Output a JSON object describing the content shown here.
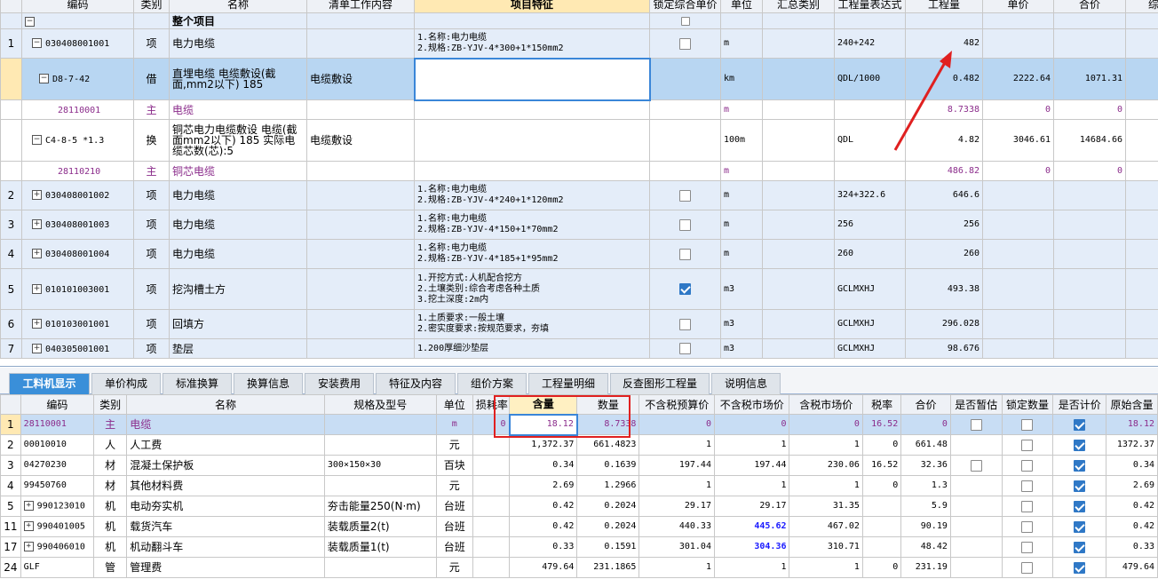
{
  "top": {
    "headers": [
      "编码",
      "类别",
      "名称",
      "清单工作内容",
      "项目特征",
      "锁定综合单价",
      "单位",
      "汇总类别",
      "工程量表达式",
      "工程量",
      "单价",
      "合价",
      "综"
    ],
    "project_row": {
      "name": "整个项目"
    },
    "rows": [
      {
        "no": "1",
        "code": "030408001001",
        "type": "项",
        "name": "电力电缆",
        "work": "",
        "feature": [
          "1.名称:电力电缆",
          "2.规格:ZB-YJV-4*300+1*150mm2"
        ],
        "unit": "m",
        "expr": "240+242",
        "qty": "482",
        "price": "",
        "total": "",
        "lock": false
      },
      {
        "no": "",
        "code": "D8-7-42",
        "type": "借",
        "name": "直埋电缆 电缆敷设(截面,mm2以下) 185",
        "work": "电缆敷设",
        "feature": [],
        "unit": "km",
        "expr": "QDL/1000",
        "qty": "0.482",
        "price": "2222.64",
        "total": "1071.31"
      },
      {
        "no": "",
        "code": "28110001",
        "type": "主",
        "name": "电缆",
        "work": "",
        "feature": [],
        "unit": "m",
        "expr": "",
        "qty": "8.7338",
        "price": "0",
        "total": "0"
      },
      {
        "no": "",
        "code": "C4-8-5 *1.3",
        "type": "换",
        "name": "铜芯电力电缆敷设 电缆(截面mm2以下) 185  实际电缆芯数(芯):5",
        "work": "电缆敷设",
        "feature": [],
        "unit": "100m",
        "expr": "QDL",
        "qty": "4.82",
        "price": "3046.61",
        "total": "14684.66"
      },
      {
        "no": "",
        "code": "28110210",
        "type": "主",
        "name": "铜芯电缆",
        "work": "",
        "feature": [],
        "unit": "m",
        "expr": "",
        "qty": "486.82",
        "price": "0",
        "total": "0"
      },
      {
        "no": "2",
        "code": "030408001002",
        "type": "项",
        "name": "电力电缆",
        "work": "",
        "feature": [
          "1.名称:电力电缆",
          "2.规格:ZB-YJV-4*240+1*120mm2"
        ],
        "unit": "m",
        "expr": "324+322.6",
        "qty": "646.6",
        "lock": false
      },
      {
        "no": "3",
        "code": "030408001003",
        "type": "项",
        "name": "电力电缆",
        "work": "",
        "feature": [
          "1.名称:电力电缆",
          "2.规格:ZB-YJV-4*150+1*70mm2"
        ],
        "unit": "m",
        "expr": "256",
        "qty": "256",
        "lock": false
      },
      {
        "no": "4",
        "code": "030408001004",
        "type": "项",
        "name": "电力电缆",
        "work": "",
        "feature": [
          "1.名称:电力电缆",
          "2.规格:ZB-YJV-4*185+1*95mm2"
        ],
        "unit": "m",
        "expr": "260",
        "qty": "260",
        "lock": false
      },
      {
        "no": "5",
        "code": "010101003001",
        "type": "项",
        "name": "挖沟槽土方",
        "work": "",
        "feature": [
          "1.开挖方式:人机配合挖方",
          "2.土壤类别:综合考虑各种土质",
          "3.挖土深度:2m内"
        ],
        "unit": "m3",
        "expr": "GCLMXHJ",
        "qty": "493.38",
        "lock": true
      },
      {
        "no": "6",
        "code": "010103001001",
        "type": "项",
        "name": "回填方",
        "work": "",
        "feature": [
          "1.土质要求:一般土壤",
          "2.密实度要求:按规范要求，夯填"
        ],
        "unit": "m3",
        "expr": "GCLMXHJ",
        "qty": "296.028",
        "lock": false
      },
      {
        "no": "7",
        "code": "040305001001",
        "type": "项",
        "name": "垫层",
        "work": "",
        "feature": [
          "1.200厚细沙垫层"
        ],
        "unit": "m3",
        "expr": "GCLMXHJ",
        "qty": "98.676",
        "lock": false
      }
    ]
  },
  "tabs": [
    "工料机显示",
    "单价构成",
    "标准换算",
    "换算信息",
    "安装费用",
    "特征及内容",
    "组价方案",
    "工程量明细",
    "反查图形工程量",
    "说明信息"
  ],
  "bottom": {
    "headers": [
      "",
      "编码",
      "类别",
      "名称",
      "规格及型号",
      "单位",
      "损耗率",
      "含量",
      "数量",
      "不含税预算价",
      "不含税市场价",
      "含税市场价",
      "税率",
      "合价",
      "是否暂估",
      "锁定数量",
      "是否计价",
      "原始含量"
    ],
    "rows": [
      {
        "no": "1",
        "code": "28110001",
        "type": "主",
        "name": "电缆",
        "spec": "",
        "unit": "m",
        "loss": "0",
        "content": "18.12",
        "qty": "8.7338",
        "pre": "0",
        "mkt": "0",
        "mkt_tax": "0",
        "tax": "16.52",
        "total": "0",
        "est": false,
        "lockq": false,
        "priced": true,
        "orig": "18.12"
      },
      {
        "no": "2",
        "code": "00010010",
        "type": "人",
        "name": "人工费",
        "spec": "",
        "unit": "元",
        "loss": "",
        "content": "1,372.37",
        "qty": "661.4823",
        "pre": "1",
        "mkt": "1",
        "mkt_tax": "1",
        "tax": "0",
        "total": "661.48",
        "est": null,
        "lockq": false,
        "priced": true,
        "orig": "1372.37"
      },
      {
        "no": "3",
        "code": "04270230",
        "type": "材",
        "name": "混凝土保护板",
        "spec": "300×150×30",
        "unit": "百块",
        "loss": "",
        "content": "0.34",
        "qty": "0.1639",
        "pre": "197.44",
        "mkt": "197.44",
        "mkt_tax": "230.06",
        "tax": "16.52",
        "total": "32.36",
        "est": false,
        "lockq": false,
        "priced": true,
        "orig": "0.34"
      },
      {
        "no": "4",
        "code": "99450760",
        "type": "材",
        "name": "其他材料费",
        "spec": "",
        "unit": "元",
        "loss": "",
        "content": "2.69",
        "qty": "1.2966",
        "pre": "1",
        "mkt": "1",
        "mkt_tax": "1",
        "tax": "0",
        "total": "1.3",
        "est": null,
        "lockq": false,
        "priced": true,
        "orig": "2.69"
      },
      {
        "no": "5",
        "code": "990123010",
        "type": "机",
        "name": "电动夯实机",
        "spec": "夯击能量250(N·m)",
        "unit": "台班",
        "loss": "",
        "content": "0.42",
        "qty": "0.2024",
        "pre": "29.17",
        "mkt": "29.17",
        "mkt_tax": "31.35",
        "tax": "",
        "total": "5.9",
        "est": null,
        "lockq": false,
        "priced": true,
        "orig": "0.42",
        "expand": true
      },
      {
        "no": "11",
        "code": "990401005",
        "type": "机",
        "name": "载货汽车",
        "spec": "装载质量2(t)",
        "unit": "台班",
        "loss": "",
        "content": "0.42",
        "qty": "0.2024",
        "pre": "440.33",
        "mkt": "445.62",
        "mkt_tax": "467.02",
        "tax": "",
        "total": "90.19",
        "est": null,
        "lockq": false,
        "priced": true,
        "orig": "0.42",
        "expand": true,
        "mkt_bold": true
      },
      {
        "no": "17",
        "code": "990406010",
        "type": "机",
        "name": "机动翻斗车",
        "spec": "装载质量1(t)",
        "unit": "台班",
        "loss": "",
        "content": "0.33",
        "qty": "0.1591",
        "pre": "301.04",
        "mkt": "304.36",
        "mkt_tax": "310.71",
        "tax": "",
        "total": "48.42",
        "est": null,
        "lockq": false,
        "priced": true,
        "orig": "0.33",
        "expand": true,
        "mkt_bold": true
      },
      {
        "no": "24",
        "code": "GLF",
        "type": "管",
        "name": "管理费",
        "spec": "",
        "unit": "元",
        "loss": "",
        "content": "479.64",
        "qty": "231.1865",
        "pre": "1",
        "mkt": "1",
        "mkt_tax": "1",
        "tax": "0",
        "total": "231.19",
        "est": null,
        "lockq": false,
        "priced": true,
        "orig": "479.64"
      }
    ]
  },
  "colors": {
    "accent": "#3a8fd9",
    "purple": "#8b2c8b",
    "annotation": "#e02020"
  }
}
